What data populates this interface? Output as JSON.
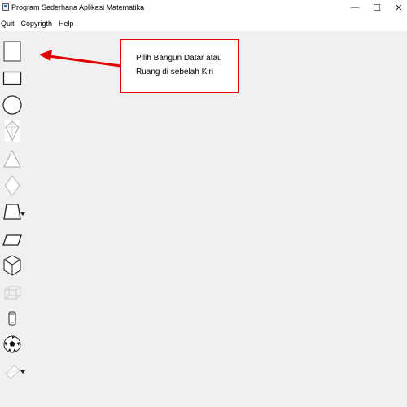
{
  "window": {
    "title": "Program Sederhana Aplikasi Matematika",
    "minimize_glyph": "—",
    "maximize_glyph": "☐",
    "close_glyph": "✕"
  },
  "menu": {
    "items": [
      "Quit",
      "Copyrigth",
      "Help"
    ]
  },
  "callout": {
    "text": "Pilih Bangun Datar atau Ruang di sebelah Kiri",
    "border_color": "#e00000",
    "arrow_color": "#e00000"
  },
  "toolbar": {
    "tools": [
      {
        "icon": "square-icon"
      },
      {
        "icon": "rectangle-icon"
      },
      {
        "icon": "circle-icon"
      },
      {
        "icon": "kite-icon"
      },
      {
        "icon": "triangle-icon"
      },
      {
        "icon": "rhombus-icon"
      },
      {
        "icon": "trapezoid-icon",
        "has_dropdown": true
      },
      {
        "icon": "parallelogram-icon"
      },
      {
        "icon": "cube-icon"
      },
      {
        "icon": "cuboid-icon"
      },
      {
        "icon": "cylinder-icon"
      },
      {
        "icon": "sphere-ball-icon"
      },
      {
        "icon": "cone-icon",
        "has_dropdown": true
      }
    ]
  }
}
